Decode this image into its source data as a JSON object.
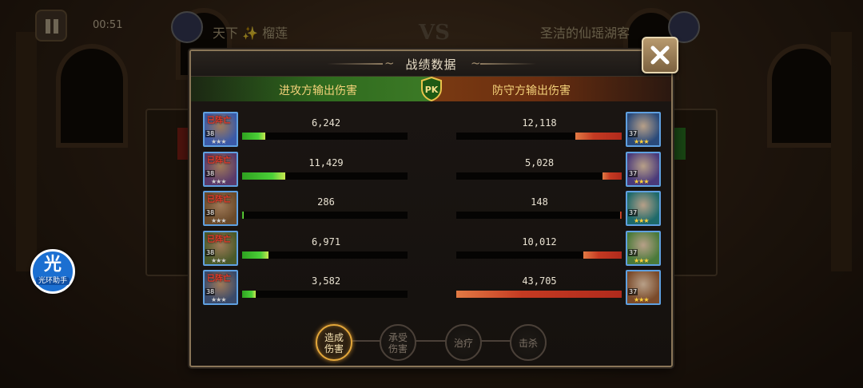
{
  "top_bar": {
    "timer": "00:51",
    "left_player": "天下 ✨ 榴莲",
    "vs": "VS",
    "right_player": "圣洁的仙瑶湖客"
  },
  "helper_badge": {
    "char": "光",
    "label": "光环助手"
  },
  "panel": {
    "title": "战绩数据",
    "attacker_header": "进攻方输出伤害",
    "defender_header": "防守方输出伤害",
    "pk_badge": "PK"
  },
  "dead_label": "已阵亡",
  "attackers": [
    {
      "level": "38",
      "dead": true,
      "damage": "6,242"
    },
    {
      "level": "38",
      "dead": true,
      "damage": "11,429"
    },
    {
      "level": "38",
      "dead": true,
      "damage": "286"
    },
    {
      "level": "38",
      "dead": true,
      "damage": "6,971"
    },
    {
      "level": "38",
      "dead": true,
      "damage": "3,582"
    }
  ],
  "defenders": [
    {
      "level": "37",
      "damage": "12,118"
    },
    {
      "level": "37",
      "damage": "5,028"
    },
    {
      "level": "37",
      "damage": "148"
    },
    {
      "level": "37",
      "damage": "10,012"
    },
    {
      "level": "37",
      "damage": "43,705"
    }
  ],
  "attacker_fill": [
    0.14,
    0.26,
    0.01,
    0.16,
    0.08
  ],
  "defender_fill": [
    0.28,
    0.115,
    0.005,
    0.23,
    1.0
  ],
  "tabs": [
    {
      "line1": "造成",
      "line2": "伤害",
      "active": true
    },
    {
      "line1": "承受",
      "line2": "伤害",
      "active": false
    },
    {
      "line1": "治疗",
      "line2": "",
      "active": false
    },
    {
      "line1": "击杀",
      "line2": "",
      "active": false
    }
  ],
  "colors": {
    "attacker_bar": "#4bd038",
    "defender_bar": "#c43a22",
    "header_text": "#f4d27a",
    "active_tab": "#e2a63a"
  },
  "icons": [
    "pause-icon",
    "close-icon",
    "pk-shield-icon",
    "star-icon"
  ]
}
